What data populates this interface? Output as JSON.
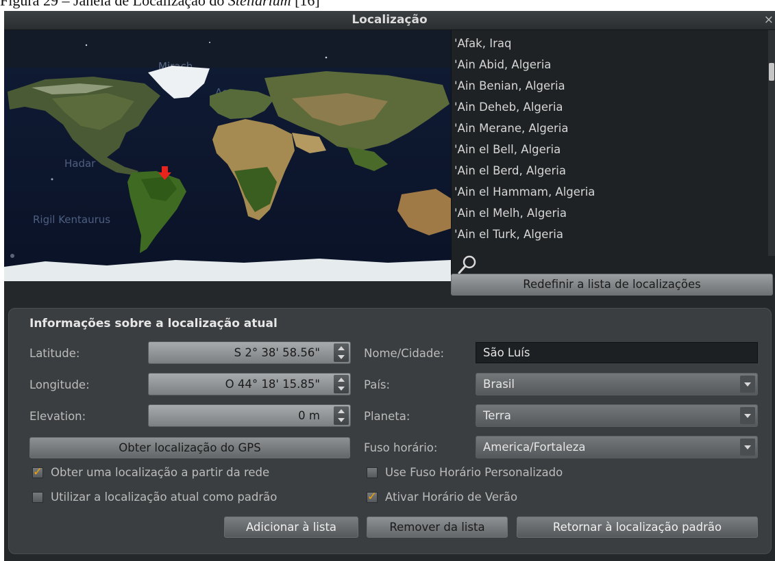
{
  "caption": {
    "prefix": "Figura 29 – Janela de Localização do ",
    "app": "Stellarium",
    "suffix": " [16]"
  },
  "window": {
    "title": "Localização",
    "close_glyph": "×"
  },
  "map": {
    "star_labels": [
      "Mirach",
      "Acrux",
      "Hadar",
      "Rigil Kentaurus"
    ]
  },
  "locations": [
    "'Afak, Iraq",
    "'Ain Abid, Algeria",
    "'Ain Benian, Algeria",
    "'Ain Deheb, Algeria",
    "'Ain Merane, Algeria",
    "'Ain el Bell, Algeria",
    "'Ain el Berd, Algeria",
    "'Ain el Hammam, Algeria",
    "'Ain el Melh, Algeria",
    "'Ain el Turk, Algeria"
  ],
  "reset_list_label": "Redefinir a lista de localizações",
  "info": {
    "heading": "Informações sobre a localização atual",
    "latitude_label": "Latitude:",
    "latitude_value": "S 2° 38' 58.56\"",
    "longitude_label": "Longitude:",
    "longitude_value": "O 44° 18' 15.85\"",
    "elevation_label": "Elevation:",
    "elevation_value": "0 m",
    "gps_button": "Obter localização do GPS",
    "network_checkbox": "Obter uma localização a partir da rede",
    "network_checked": true,
    "default_checkbox": "Utilizar a localização atual como padrão",
    "default_checked": false,
    "name_label": "Nome/Cidade:",
    "name_value": "São Luís",
    "country_label": "País:",
    "country_value": "Brasil",
    "planet_label": "Planeta:",
    "planet_value": "Terra",
    "timezone_label": "Fuso horário:",
    "timezone_value": "America/Fortaleza",
    "custom_tz_checkbox": "Use Fuso Horário Personalizado",
    "custom_tz_checked": false,
    "dst_checkbox": "Ativar Horário de Verão",
    "dst_checked": true,
    "add_button": "Adicionar à lista",
    "remove_button": "Remover da lista",
    "return_button": "Retornar à localização padrão"
  },
  "colors": {
    "accent_check": "#f0a000",
    "marker": "#e8241c",
    "window_bg": "#24282a"
  },
  "icons": {
    "search": "search-icon",
    "close": "close-icon",
    "marker": "location-marker-icon"
  }
}
